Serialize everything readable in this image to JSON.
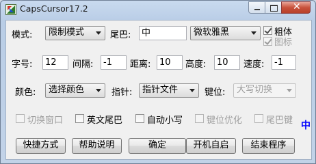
{
  "window": {
    "title": "CapsCursor17.2"
  },
  "row1": {
    "mode_label": "模式:",
    "mode_value": "限制模式",
    "tail_label": "尾巴:",
    "tail_value": "中",
    "font_value": "微软雅黑",
    "bold_label": "粗体",
    "bold_checked": true,
    "icon_label": "图标",
    "icon_checked": true
  },
  "row2": {
    "size_label": "字号:",
    "size_value": "12",
    "gap_label": "间隔:",
    "gap_value": "-1",
    "distance_label": "距离:",
    "distance_value": "10",
    "height_label": "高度:",
    "height_value": "10",
    "speed_label": "速度:",
    "speed_value": "-1"
  },
  "row3": {
    "color_label": "颜色:",
    "color_value": "选择颜色",
    "pointer_label": "指针:",
    "pointer_value": "指针文件",
    "key_label": "键位:",
    "key_value": "大写切换"
  },
  "row4": {
    "switch_window": "切换窗口",
    "english_tail": "英文尾巴",
    "auto_lower": "自动小写",
    "key_optimize": "键位优化",
    "tail_key": "尾巴键",
    "indicator": "中"
  },
  "buttons": {
    "shortcut": "快捷方式",
    "help": "帮助说明",
    "ok": "确定",
    "autostart": "开机自启",
    "exit": "结束程序"
  },
  "colors": {
    "indicator": "#0000ff",
    "titlebar": "#c9daef",
    "close": "#c8523c"
  }
}
